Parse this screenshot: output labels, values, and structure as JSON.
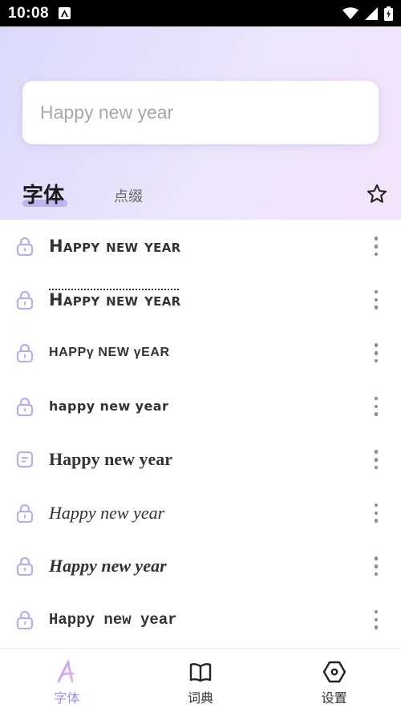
{
  "status_bar": {
    "time": "10:08"
  },
  "search": {
    "placeholder": "Happy new year"
  },
  "tabs": {
    "fonts": "字体",
    "decorations": "点缀"
  },
  "font_list": [
    {
      "text": "Happy new year",
      "icon": "lock-icon"
    },
    {
      "text": "Happy new year",
      "icon": "lock-icon"
    },
    {
      "text": "HAPPγ NEW γEAR",
      "icon": "lock-icon"
    },
    {
      "text": "happy new year",
      "icon": "lock-icon"
    },
    {
      "text": "Happy new year",
      "icon": "note-icon"
    },
    {
      "text": "Happy new year",
      "icon": "lock-icon"
    },
    {
      "text": "Happy new year",
      "icon": "lock-icon"
    },
    {
      "text": "Happy new year",
      "icon": "lock-icon"
    }
  ],
  "bottom_nav": [
    {
      "label": "字体",
      "icon": "font-a-icon",
      "active": true
    },
    {
      "label": "词典",
      "icon": "book-icon",
      "active": false
    },
    {
      "label": "设置",
      "icon": "settings-hex-icon",
      "active": false
    }
  ],
  "colors": {
    "accent": "#9d8ff0",
    "icon_lavender": "#b7aef0",
    "header_start": "#dcd9fb",
    "header_end": "#f4e4fb"
  }
}
